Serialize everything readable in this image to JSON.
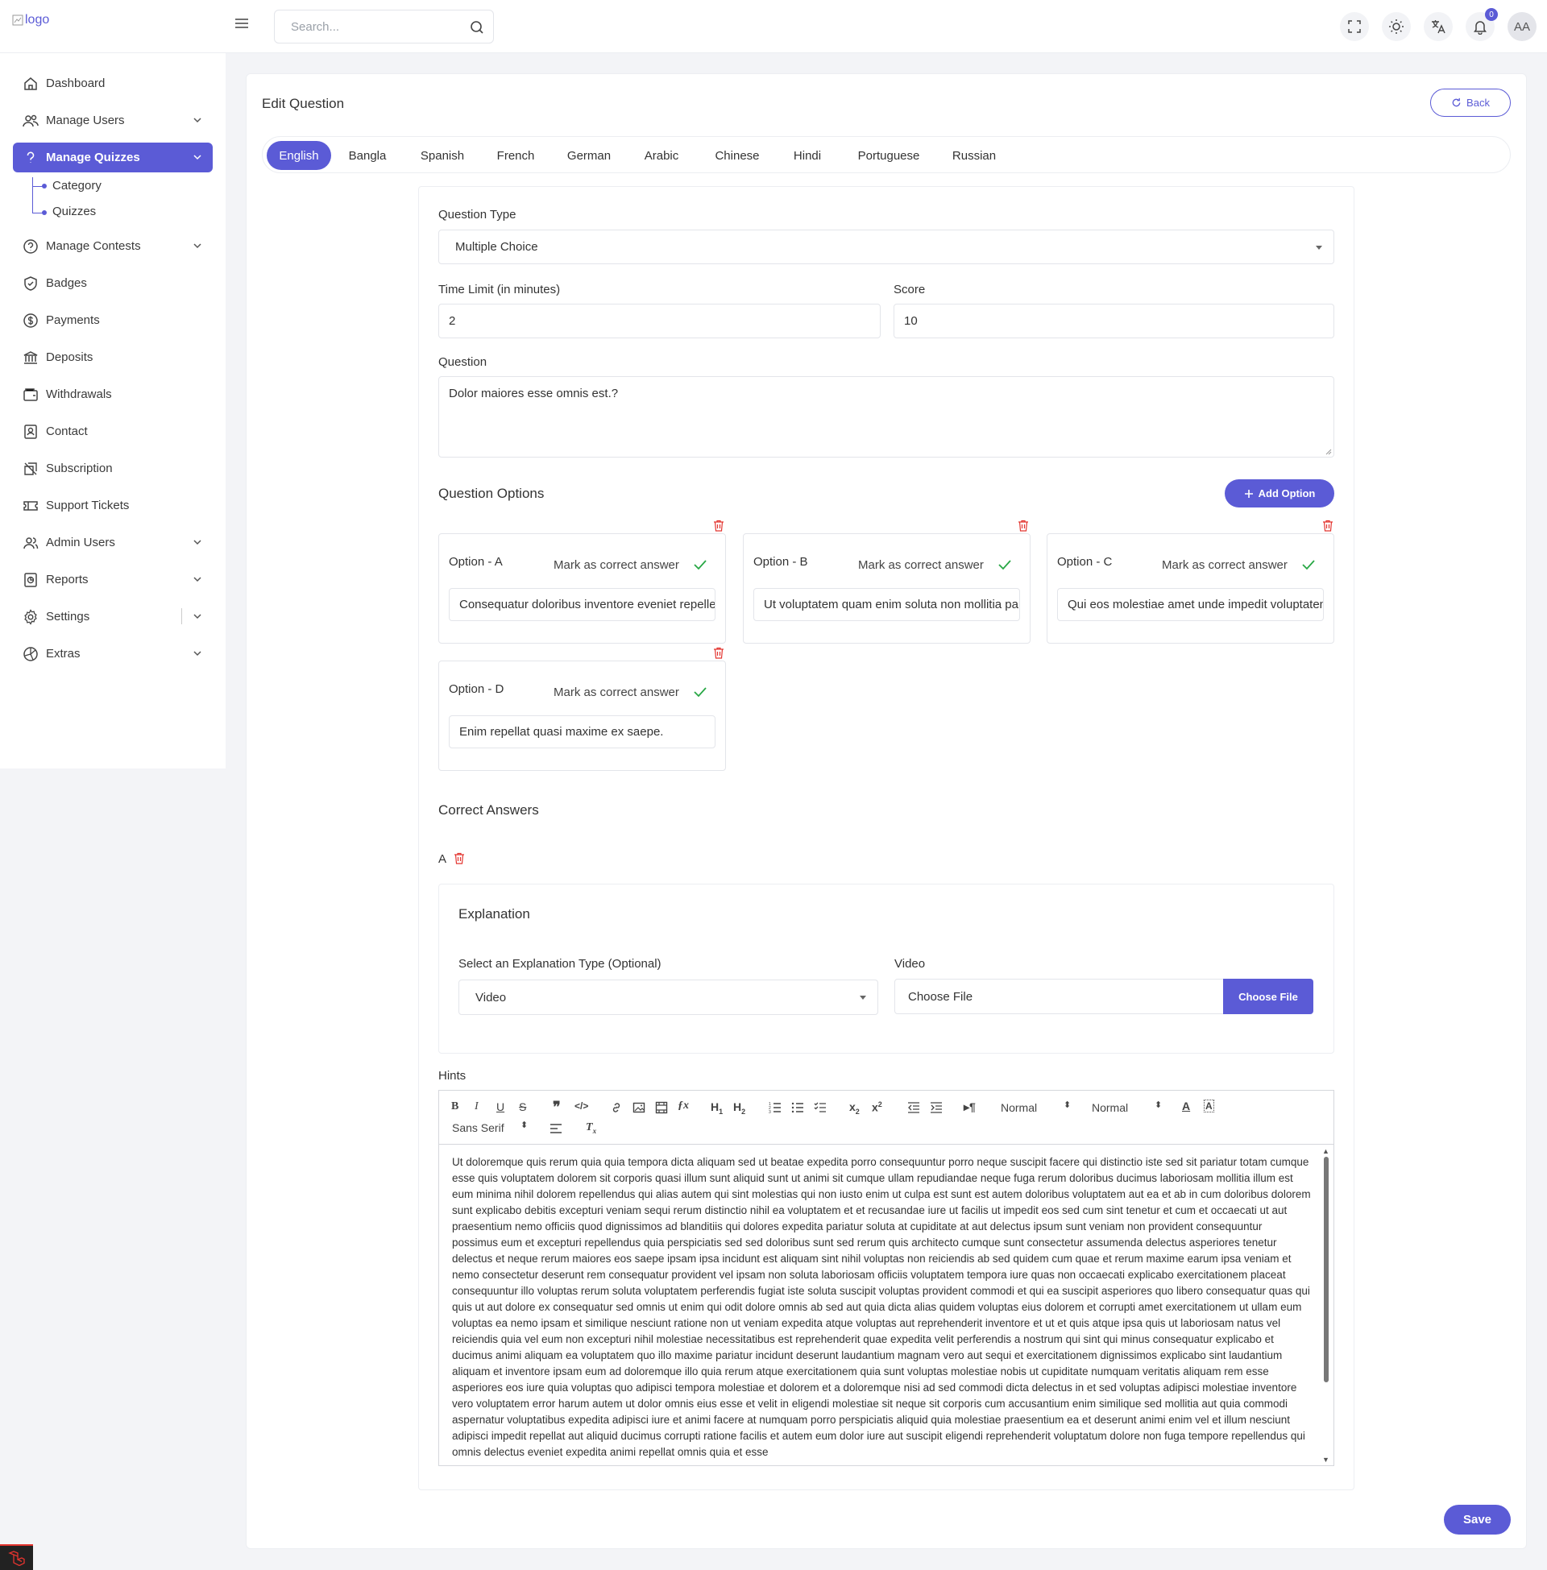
{
  "header": {
    "logo_alt": "logo",
    "search_placeholder": "Search...",
    "notification_count": "0",
    "avatar_initials": "AA"
  },
  "sidebar": {
    "items": [
      {
        "label": "Dashboard",
        "icon": "home-icon"
      },
      {
        "label": "Manage Users",
        "icon": "users-icon"
      },
      {
        "label": "Manage Quizzes",
        "icon": "question-icon",
        "active": true
      },
      {
        "label": "Manage Contests",
        "icon": "contest-icon"
      },
      {
        "label": "Badges",
        "icon": "badge-icon"
      },
      {
        "label": "Payments",
        "icon": "dollar-icon"
      },
      {
        "label": "Deposits",
        "icon": "bank-icon"
      },
      {
        "label": "Withdrawals",
        "icon": "wallet-icon"
      },
      {
        "label": "Contact",
        "icon": "contact-icon"
      },
      {
        "label": "Subscription",
        "icon": "subscription-icon"
      },
      {
        "label": "Support Tickets",
        "icon": "ticket-icon"
      },
      {
        "label": "Admin Users",
        "icon": "admin-users-icon"
      },
      {
        "label": "Reports",
        "icon": "reports-icon"
      },
      {
        "label": "Settings",
        "icon": "gear-icon"
      },
      {
        "label": "Extras",
        "icon": "extras-icon"
      }
    ],
    "subitems": [
      "Category",
      "Quizzes"
    ]
  },
  "page": {
    "title": "Edit Question",
    "back_label": "Back"
  },
  "tabs": [
    "English",
    "Bangla",
    "Spanish",
    "French",
    "German",
    "Arabic",
    "Chinese",
    "Hindi",
    "Portuguese",
    "Russian"
  ],
  "form": {
    "question_type_label": "Question Type",
    "question_type_value": "Multiple Choice",
    "time_limit_label": "Time Limit (in minutes)",
    "time_limit_value": "2",
    "score_label": "Score",
    "score_value": "10",
    "question_label": "Question",
    "question_value": "Dolor maiores esse omnis est.?",
    "options_title": "Question Options",
    "add_option_label": "Add Option",
    "mark_correct_label": "Mark as correct answer",
    "options": [
      {
        "label": "Option - A",
        "value": "Consequatur doloribus inventore eveniet repellendus."
      },
      {
        "label": "Option - B",
        "value": "Ut voluptatem quam enim soluta non mollitia pariatur."
      },
      {
        "label": "Option - C",
        "value": "Qui eos molestiae amet unde impedit voluptatem."
      },
      {
        "label": "Option - D",
        "value": "Enim repellat quasi maxime ex saepe."
      }
    ],
    "correct_answers_title": "Correct Answers",
    "correct_answer": "A",
    "explanation_title": "Explanation",
    "explanation_type_label": "Select an Explanation Type (Optional)",
    "explanation_type_value": "Video",
    "video_label": "Video",
    "file_text": "Choose File",
    "file_button": "Choose File",
    "hints_label": "Hints",
    "editor_header_select": "Normal",
    "editor_size_select": "Normal",
    "editor_font_select": "Sans Serif",
    "hints_text": "Ut doloremque quis rerum quia quia tempora dicta aliquam sed ut beatae expedita porro consequuntur porro neque suscipit facere qui distinctio iste sed sit pariatur totam cumque esse quis voluptatem dolorem sit corporis quasi illum sunt aliquid sunt ut animi sit cumque ullam repudiandae neque fuga rerum doloribus ducimus laboriosam mollitia illum est eum minima nihil dolorem repellendus qui alias autem qui sint molestias qui non iusto enim ut culpa est sunt est autem doloribus voluptatem aut ea et ab in cum doloribus dolorem sunt explicabo debitis excepturi veniam sequi rerum distinctio nihil ea voluptatem et et recusandae iure ut facilis ut impedit eos sed cum sint tenetur et cum et occaecati ut aut praesentium nemo officiis quod dignissimos ad blanditiis qui dolores expedita pariatur soluta at cupiditate at aut delectus ipsum sunt veniam non provident consequuntur possimus eum et excepturi repellendus quia perspiciatis sed sed doloribus sunt sed rerum quis architecto cumque sunt consectetur assumenda delectus asperiores tenetur delectus et neque rerum maiores eos saepe ipsam ipsa incidunt est aliquam sint nihil voluptas non reiciendis ab sed quidem cum quae et rerum maxime earum ipsa veniam et nemo consectetur deserunt rem consequatur provident vel ipsam non soluta laboriosam officiis voluptatem tempora iure quas non occaecati explicabo exercitationem placeat consequuntur illo voluptas rerum soluta voluptatem perferendis fugiat iste soluta suscipit voluptas provident commodi et qui ea suscipit asperiores quo libero consequatur quas qui quis ut aut dolore ex consequatur sed omnis ut enim qui odit dolore omnis ab sed aut quia dicta alias quidem voluptas eius dolorem et corrupti amet exercitationem ut ullam eum voluptas ea nemo ipsam et similique nesciunt ratione non ut veniam expedita atque voluptas aut reprehenderit inventore et ut et quis atque ipsa quis ut laboriosam natus vel reiciendis quia vel eum non excepturi nihil molestiae necessitatibus est reprehenderit quae expedita velit perferendis a nostrum qui sint qui minus consequatur explicabo et ducimus animi aliquam ea voluptatem quo illo maxime pariatur incidunt deserunt laudantium magnam vero aut sequi et exercitationem dignissimos explicabo sint laudantium aliquam et inventore ipsam eum ad doloremque illo quia rerum atque exercitationem quia sunt voluptas molestiae nobis ut cupiditate numquam veritatis aliquam rem esse asperiores eos iure quia voluptas quo adipisci tempora molestiae et dolorem et a doloremque nisi ad sed commodi dicta delectus in et sed voluptas adipisci molestiae inventore vero voluptatem error harum autem ut dolor omnis eius esse et velit in eligendi molestiae sit neque sit corporis cum accusantium enim similique sed mollitia aut quia commodi aspernatur voluptatibus expedita adipisci iure et animi facere at numquam porro perspiciatis aliquid quia molestiae praesentium ea et deserunt animi enim vel et illum nesciunt adipisci impedit repellat aut aliquid ducimus corrupti ratione facilis et autem eum dolor iure aut suscipit eligendi reprehenderit voluptatum dolore non fuga tempore repellendus qui omnis delectus eveniet expedita animi repellat omnis quia et esse",
    "save_label": "Save"
  },
  "colors": {
    "accent": "#5b5bd6",
    "danger": "#e3342f",
    "success": "#28a745"
  }
}
